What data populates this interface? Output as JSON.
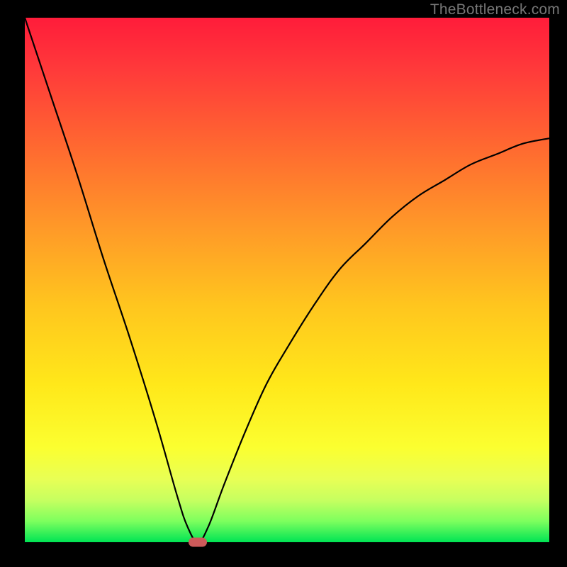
{
  "watermark": "TheBottleneck.com",
  "colors": {
    "frame": "#000000",
    "curve": "#000000",
    "marker": "#cc5a5a",
    "watermark": "#777777"
  },
  "chart_data": {
    "type": "line",
    "title": "",
    "xlabel": "",
    "ylabel": "",
    "xlim": [
      0,
      100
    ],
    "ylim": [
      0,
      100
    ],
    "grid": false,
    "legend": false,
    "series": [
      {
        "name": "bottleneck-curve",
        "x": [
          0,
          5,
          10,
          15,
          20,
          25,
          29,
          31,
          33,
          35,
          38,
          42,
          46,
          50,
          55,
          60,
          65,
          70,
          75,
          80,
          85,
          90,
          95,
          100
        ],
        "y": [
          100,
          85,
          70,
          54,
          39,
          23,
          9,
          3,
          0,
          3,
          11,
          21,
          30,
          37,
          45,
          52,
          57,
          62,
          66,
          69,
          72,
          74,
          76,
          77
        ]
      }
    ],
    "annotations": [
      {
        "name": "minimum-marker",
        "x": 33,
        "y": 0,
        "shape": "pill",
        "color": "#cc5a5a"
      }
    ],
    "background_gradient": {
      "direction": "vertical",
      "stops": [
        {
          "pos": 0.0,
          "color": "#ff1c3a"
        },
        {
          "pos": 0.1,
          "color": "#ff3a3a"
        },
        {
          "pos": 0.25,
          "color": "#ff6a30"
        },
        {
          "pos": 0.4,
          "color": "#ff9928"
        },
        {
          "pos": 0.55,
          "color": "#ffc61e"
        },
        {
          "pos": 0.7,
          "color": "#ffe81a"
        },
        {
          "pos": 0.82,
          "color": "#fbff30"
        },
        {
          "pos": 0.88,
          "color": "#e8ff55"
        },
        {
          "pos": 0.92,
          "color": "#c6ff60"
        },
        {
          "pos": 0.96,
          "color": "#7dff5e"
        },
        {
          "pos": 1.0,
          "color": "#00e454"
        }
      ]
    }
  }
}
